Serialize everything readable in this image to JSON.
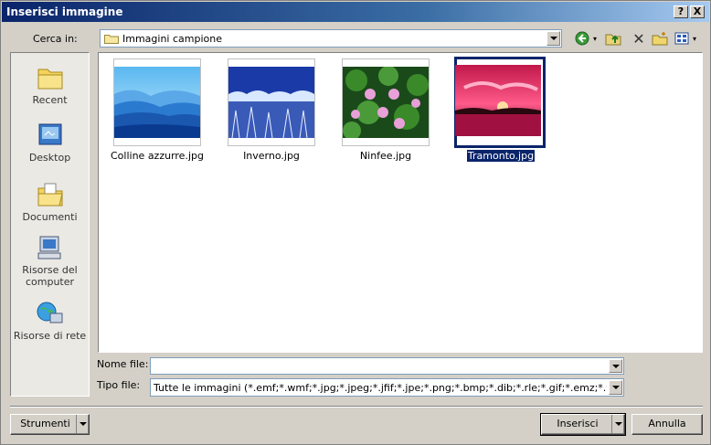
{
  "window": {
    "title": "Inserisci immagine",
    "help_glyph": "?",
    "close_glyph": "X"
  },
  "lookin": {
    "label": "Cerca in:",
    "value": "Immagini campione"
  },
  "places": [
    {
      "label": "Recent"
    },
    {
      "label": "Desktop"
    },
    {
      "label": "Documenti"
    },
    {
      "label": "Risorse del computer"
    },
    {
      "label": "Risorse di rete"
    }
  ],
  "files": [
    {
      "name": "Colline azzurre.jpg",
      "selected": false
    },
    {
      "name": "Inverno.jpg",
      "selected": false
    },
    {
      "name": "Ninfee.jpg",
      "selected": false
    },
    {
      "name": "Tramonto.jpg",
      "selected": true
    }
  ],
  "filename": {
    "label": "Nome file:",
    "value": ""
  },
  "filetype": {
    "label": "Tipo file:",
    "value": "Tutte le immagini (*.emf;*.wmf;*.jpg;*.jpeg;*.jfif;*.jpe;*.png;*.bmp;*.dib;*.rle;*.gif;*.emz;*.wmz;*.p"
  },
  "buttons": {
    "tools": "Strumenti",
    "insert": "Inserisci",
    "cancel": "Annulla"
  },
  "colors": {
    "title_start": "#0a246a",
    "title_end": "#a6caf0",
    "selection": "#0a246a"
  }
}
